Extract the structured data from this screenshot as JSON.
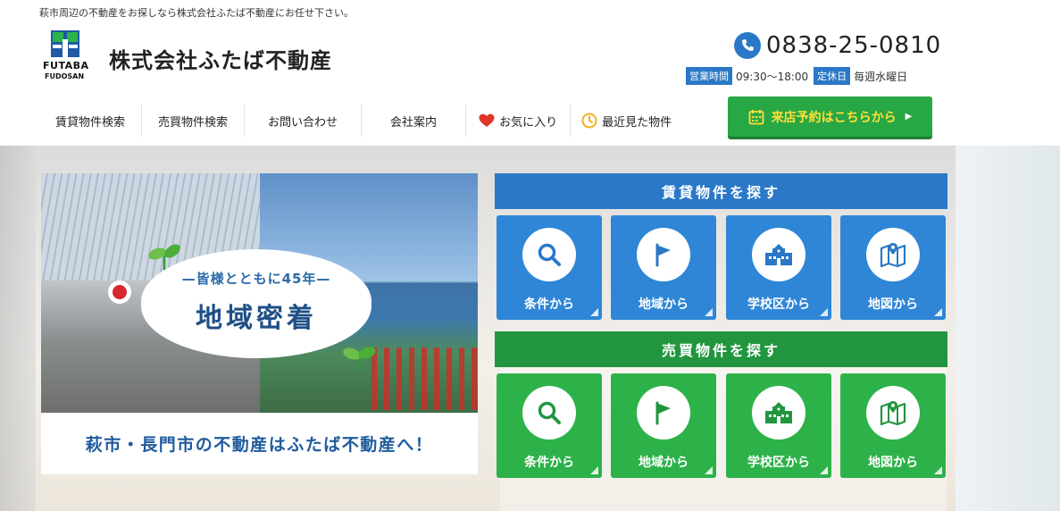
{
  "header": {
    "tagline": "萩市周辺の不動産をお探しなら株式会社ふたば不動産にお任せ下さい。",
    "logo_line1": "FUTABA",
    "logo_line2": "FUDOSAN",
    "company_name": "株式会社ふたば不動産",
    "phone": "0838-25-0810",
    "hours_label": "営業時間",
    "hours_value": "09:30〜18:00",
    "holiday_label": "定休日",
    "holiday_value": "毎週水曜日"
  },
  "nav": {
    "items": [
      {
        "label": "賃貸物件検索"
      },
      {
        "label": "売買物件検索"
      },
      {
        "label": "お問い合わせ"
      },
      {
        "label": "会社案内"
      },
      {
        "label": "お気に入り",
        "icon": "heart-icon"
      },
      {
        "label": "最近見た物件",
        "icon": "clock-icon"
      }
    ],
    "reserve_button": "来店予約はこちらから"
  },
  "hero": {
    "bubble_sub": "—皆様とともに45年—",
    "bubble_main": "地域密着",
    "caption": "萩市・長門市の不動産はふたば不動産へ！"
  },
  "rental": {
    "heading": "賃貸物件を探す",
    "tiles": [
      {
        "label": "条件から",
        "icon": "search-icon"
      },
      {
        "label": "地域から",
        "icon": "flag-icon"
      },
      {
        "label": "学校区から",
        "icon": "school-icon"
      },
      {
        "label": "地図から",
        "icon": "map-icon"
      }
    ]
  },
  "sale": {
    "heading": "売買物件を探す",
    "tiles": [
      {
        "label": "条件から",
        "icon": "search-icon"
      },
      {
        "label": "地域から",
        "icon": "flag-icon"
      },
      {
        "label": "学校区から",
        "icon": "school-icon"
      },
      {
        "label": "地図から",
        "icon": "map-icon"
      }
    ]
  },
  "colors": {
    "brand_blue": "#2a78c7",
    "brand_green": "#2db24a",
    "reserve_green": "#28a745"
  }
}
